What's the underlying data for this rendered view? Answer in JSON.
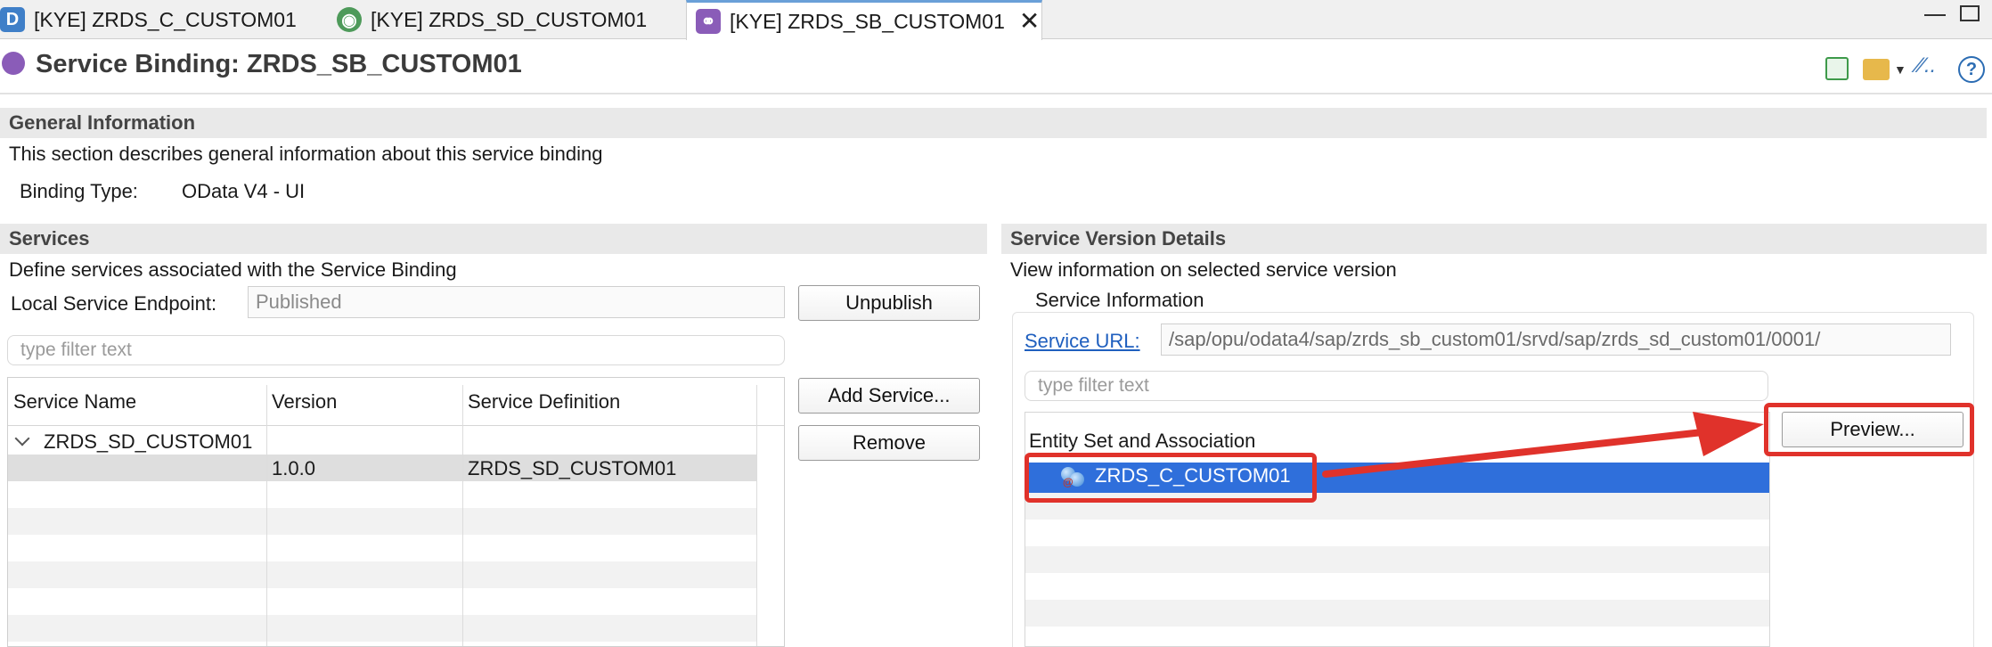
{
  "tabs": [
    {
      "label": "[KYE] ZRDS_C_CUSTOM01",
      "icon": "data-definition-icon"
    },
    {
      "label": "[KYE] ZRDS_SD_CUSTOM01",
      "icon": "service-definition-icon"
    },
    {
      "label": "[KYE] ZRDS_SB_CUSTOM01",
      "icon": "service-binding-icon",
      "active": true
    }
  ],
  "editor": {
    "title": "Service Binding: ZRDS_SB_CUSTOM01",
    "toolbar_icons": [
      "activate-icon",
      "open-folder-icon",
      "link-icon",
      "help-icon"
    ]
  },
  "general": {
    "header": "General Information",
    "description": "This section describes general information about this service binding",
    "binding_type_label": "Binding Type:",
    "binding_type_value": "OData V4 - UI"
  },
  "services": {
    "header": "Services",
    "description": "Define services associated with the Service Binding",
    "endpoint_label": "Local Service Endpoint:",
    "endpoint_value": "Published",
    "unpublish_label": "Unpublish",
    "filter_placeholder": "type filter text",
    "add_service_label": "Add Service...",
    "remove_label": "Remove",
    "columns": [
      "Service Name",
      "Version",
      "Service Definition"
    ],
    "rows": [
      {
        "name": "ZRDS_SD_CUSTOM01",
        "version": "",
        "definition": ""
      },
      {
        "name": "",
        "version": "1.0.0",
        "definition": "ZRDS_SD_CUSTOM01"
      }
    ]
  },
  "version_details": {
    "header": "Service Version Details",
    "description": "View information on selected service version",
    "group_title": "Service Information",
    "service_url_label": "Service URL:",
    "service_url_value": "/sap/opu/odata4/sap/zrds_sb_custom01/srvd/sap/zrds_sd_custom01/0001/",
    "filter_placeholder": "type filter text",
    "entity_header": "Entity Set and Association",
    "entities": [
      "ZRDS_C_CUSTOM01"
    ],
    "preview_label": "Preview..."
  },
  "annotation": {
    "highlight_color": "#e0322b",
    "selection_color": "#2f6fdb"
  }
}
